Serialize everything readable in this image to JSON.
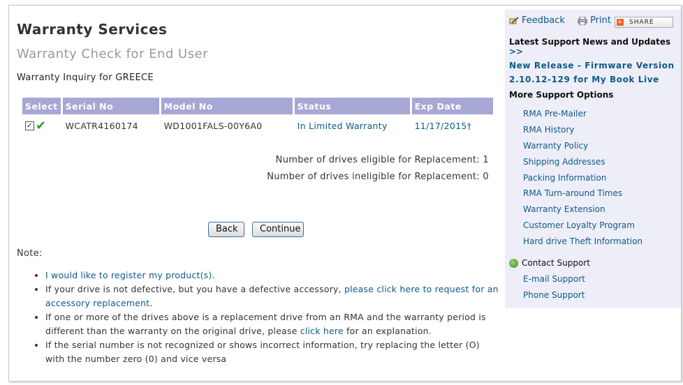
{
  "page": {
    "title": "Warranty Services",
    "subtitle": "Warranty Check for End User",
    "inquiry": "Warranty Inquiry for GREECE"
  },
  "table": {
    "headers": [
      "Select",
      "Serial No",
      "Model No",
      "Status",
      "Exp Date"
    ],
    "rows": [
      {
        "selected": true,
        "serial": "WCATR4160174",
        "model": "WD1001FALS-00Y6A0",
        "status": "In Limited Warranty",
        "exp_date": "11/17/2015†"
      }
    ]
  },
  "counts": {
    "eligible_label": "Number of drives eligible for Replacement:",
    "eligible_value": "1",
    "ineligible_label": "Number of drives ineligible for Replacement:",
    "ineligible_value": "0"
  },
  "buttons": {
    "back": "Back",
    "continue": "Continue"
  },
  "notes": {
    "label": "Note:",
    "item1_link": "I would like to register my product(s)",
    "item1_tail": ".",
    "item2_text": "If your drive is not defective, but you have a defective accessory, ",
    "item2_link": "please click here to request for an accessory replacement",
    "item2_tail": ".",
    "item3_text": "If one or more of the drives above is a replacement drive from an RMA and the warranty period is different than the warranty on the original drive, please ",
    "item3_link": "click here",
    "item3_tail": " for an explanation.",
    "item4_text": "If the serial number is not recognized or shows incorrect information, try replacing the letter (O) with the number zero (0) and vice versa"
  },
  "sidebar": {
    "feedback": "Feedback",
    "print": "Print",
    "share": "SHARE",
    "news_heading": "Latest Support News and Updates",
    "news_arrow": ">>",
    "release_line1": "New Release - Firmware Version",
    "release_line2": "2.10.12-129 for My Book Live",
    "more_heading": "More Support Options",
    "options": [
      "RMA Pre-Mailer",
      "RMA History",
      "Warranty Policy",
      "Shipping Addresses",
      "Packing Information",
      "RMA Turn-around Times",
      "Warranty Extension",
      "Customer Loyalty Program",
      "Hard drive Theft Information"
    ],
    "contact_heading": "Contact Support",
    "contact_links": [
      "E-mail Support",
      "Phone Support"
    ]
  },
  "colors": {
    "header_bg": "#a7a7d6",
    "link": "#0d5a8a",
    "sidebar_bg": "#eeeef8",
    "check": "#2aa22a"
  },
  "icons": [
    "pencil-feedback-icon",
    "printer-icon",
    "share-plus-icon",
    "checkmark-icon",
    "globe-icon"
  ]
}
